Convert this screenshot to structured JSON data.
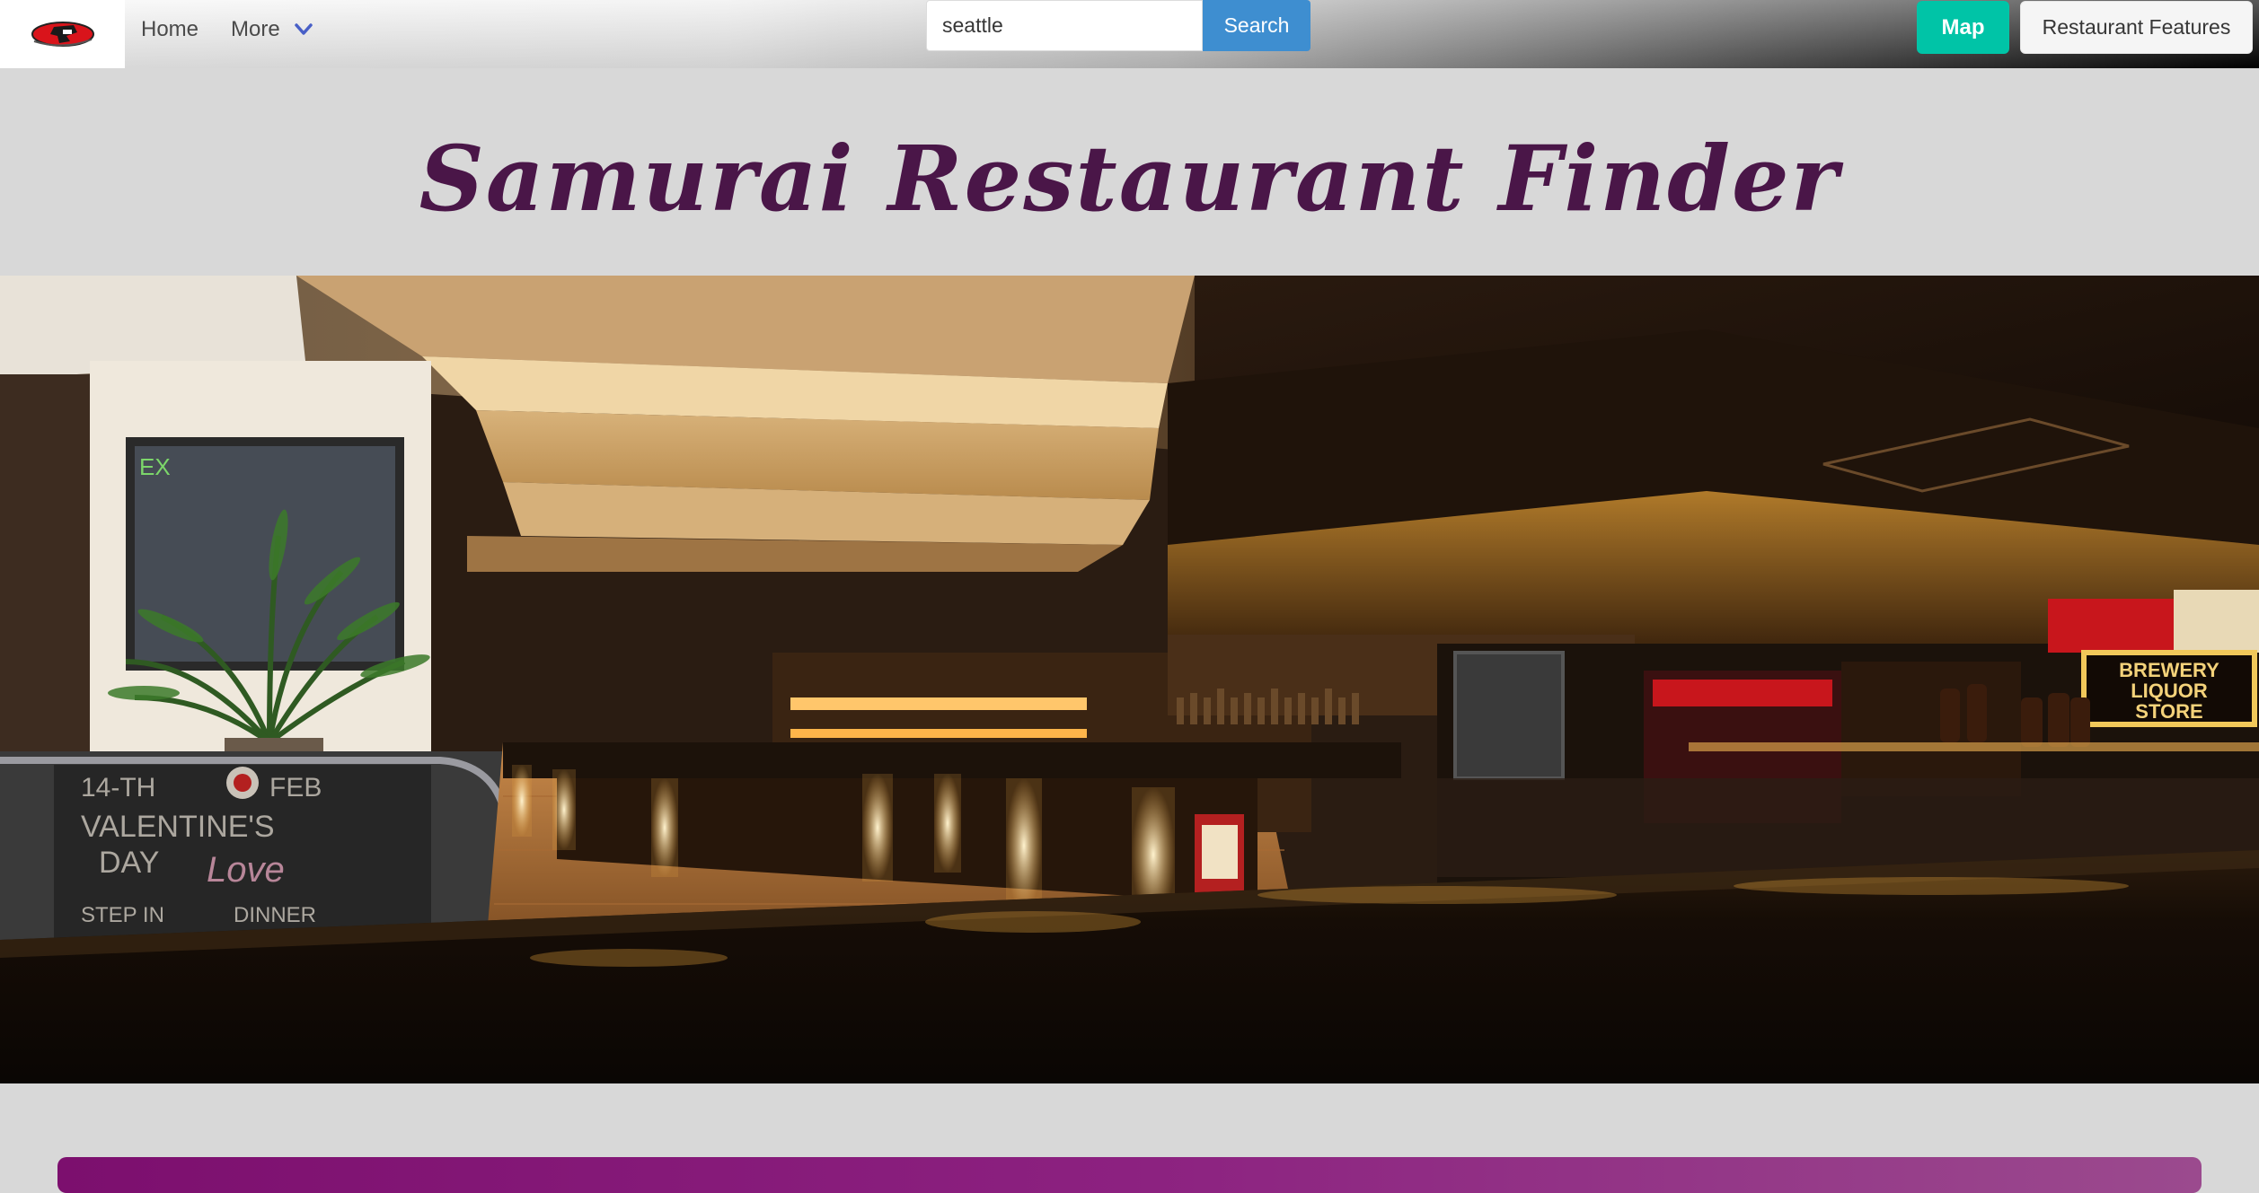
{
  "nav": {
    "home_label": "Home",
    "more_label": "More",
    "search_value": "seattle",
    "search_button": "Search",
    "map_button": "Map",
    "features_button": "Restaurant Features"
  },
  "hero": {
    "title": "Samurai Restaurant Finder"
  },
  "photo": {
    "exit_sign": "EX",
    "chalkboard_text": [
      "14-TH",
      "FEB",
      "VALENTINE'S",
      "DAY",
      "Love",
      "STEP IN",
      "DINNER"
    ],
    "store_sign": [
      "BREWERY",
      "LIQUOR",
      "STORE"
    ]
  },
  "colors": {
    "title": "#4a1648",
    "search_button": "#3e8ed0",
    "map_button": "#00c4a7",
    "banner": "#8c2180"
  },
  "icons": {
    "logo": "samurai-logo-icon",
    "more_chevron": "chevron-down-icon"
  }
}
